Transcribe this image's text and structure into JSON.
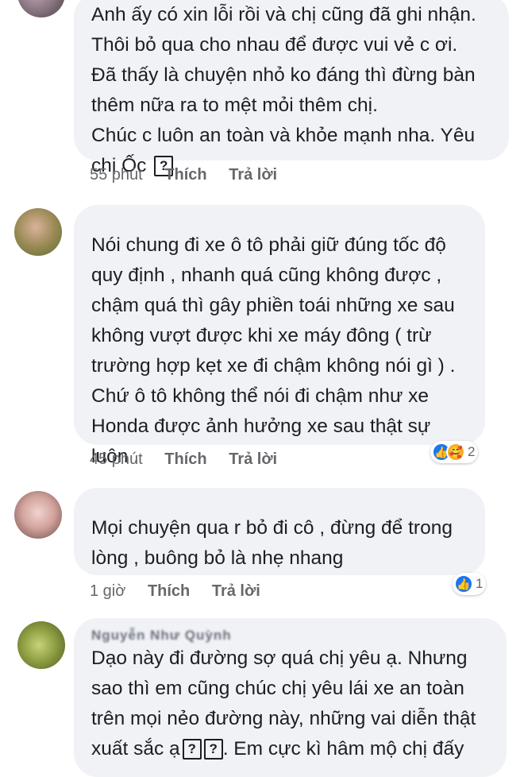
{
  "comments": [
    {
      "author": "",
      "text_lines": [
        "Anh ấy có xin lỗi rồi và chị cũng đã ghi nhận.",
        "Thôi bỏ qua cho nhau để được vui vẻ c ơi.",
        "Đã thấy là chuyện nhỏ ko đáng thì đừng bàn",
        "thêm nữa ra to mệt mỏi thêm chị.",
        "Chúc c luôn an toàn và khỏe mạnh nha. Yêu",
        "chị Ốc"
      ],
      "glyph": "?",
      "time": "55 phút",
      "like_label": "Thích",
      "reply_label": "Trả lời"
    },
    {
      "author": "",
      "text": "Nói chung đi xe ô tô phải giữ đúng tốc độ\nquy định , nhanh quá cũng không được ,\nchậm quá thì gây phiền toái những xe sau\nkhông vượt được khi xe máy đông ( trừ\ntrường hợp kẹt xe đi chậm không nói gì ) .\nChứ ô tô không thể nói đi chậm như xe\nHonda được ảnh hưởng xe sau thật sự\nluôn .",
      "time": "45 phút",
      "like_label": "Thích",
      "reply_label": "Trả lời",
      "reaction_count": "2",
      "reaction_icons": [
        "like-icon",
        "care-icon"
      ]
    },
    {
      "author": "",
      "text": "Mọi chuyện qua r bỏ đi cô , đừng để trong\nlòng , buông bỏ là nhẹ nhang",
      "time": "1 giờ",
      "like_label": "Thích",
      "reply_label": "Trả lời",
      "reaction_count": "1",
      "reaction_icons": [
        "like-icon"
      ]
    },
    {
      "author": "Nguyễn Như Quỳnh",
      "text_lines": [
        "Dạo này đi đường sợ quá chị yêu ạ.  Nhưng",
        "sao thì em cũng chúc chị yêu lái xe an toàn",
        "trên mọi nẻo đường này, những vai diễn thật",
        "xuất sắc ạ"
      ],
      "glyph": "?",
      "tail": " Em cực kì hâm mộ chị đấy"
    }
  ],
  "colors": {
    "bubble": "#f0f2f5",
    "meta": "#65676b",
    "like": "#1877f2",
    "care": "#f7b125"
  }
}
